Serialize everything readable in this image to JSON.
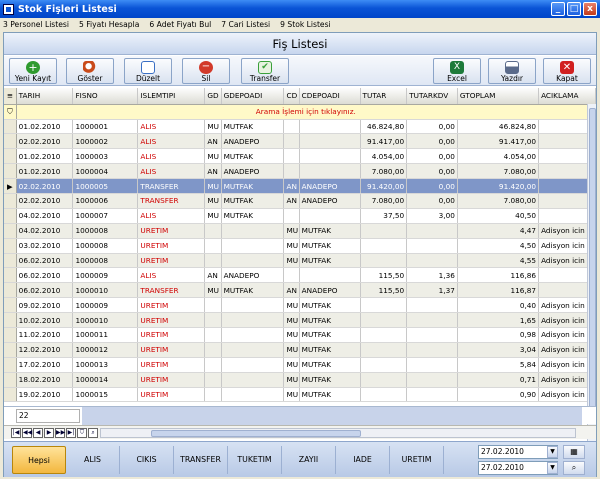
{
  "window": {
    "title": "Stok Fişleri Listesi",
    "minimize": "_",
    "maximize": "□",
    "close": "x"
  },
  "menu": [
    "3 Personel Listesi",
    "5 Fiyatı Hesapla",
    "6 Adet Fiyatı Bul",
    "7 Cari Listesi",
    "9 Stok Listesi"
  ],
  "header": {
    "title": "Fiş Listesi"
  },
  "toolbar": [
    {
      "label": "Yeni Kayıt",
      "icon": "add-icon",
      "color": "#2e9a2e"
    },
    {
      "label": "Göster",
      "icon": "search-icon",
      "color": "#c94a1a"
    },
    {
      "label": "Düzelt",
      "icon": "edit-icon",
      "color": "#3a6fc4"
    },
    {
      "label": "Sil",
      "icon": "delete-icon",
      "color": "#d23a2a"
    },
    {
      "label": "Transfer",
      "icon": "transfer-icon",
      "color": "#3aa03a"
    },
    {
      "label": "Excel",
      "icon": "excel-icon",
      "color": "#1d7a3a"
    },
    {
      "label": "Yazdır",
      "icon": "print-icon",
      "color": "#5a6a8a"
    },
    {
      "label": "Kapat",
      "icon": "close-icon",
      "color": "#d12020"
    }
  ],
  "grid": {
    "columns": [
      "TARIH",
      "FISNO",
      "ISLEMTIPI",
      "GD",
      "GDEPOADI",
      "CD",
      "CDEPOADI",
      "TUTAR",
      "TUTARKDV",
      "GTOPLAM",
      "ACIKLAMA"
    ],
    "filter_message": "Arama İşlemi için tıklayınız.",
    "rows": [
      [
        "01.02.2010",
        "1000001",
        "ALIS",
        "MU",
        "MUTFAK",
        "",
        "",
        "46.824,80",
        "0,00",
        "46.824,80",
        ""
      ],
      [
        "02.02.2010",
        "1000002",
        "ALIS",
        "AN",
        "ANADEPO",
        "",
        "",
        "91.417,00",
        "0,00",
        "91.417,00",
        ""
      ],
      [
        "01.02.2010",
        "1000003",
        "ALIS",
        "MU",
        "MUTFAK",
        "",
        "",
        "4.054,00",
        "0,00",
        "4.054,00",
        ""
      ],
      [
        "01.02.2010",
        "1000004",
        "ALIS",
        "AN",
        "ANADEPO",
        "",
        "",
        "7.080,00",
        "0,00",
        "7.080,00",
        ""
      ],
      [
        "02.02.2010",
        "1000005",
        "TRANSFER",
        "MU",
        "MUTFAK",
        "AN",
        "ANADEPO",
        "91.420,00",
        "0,00",
        "91.420,00",
        ""
      ],
      [
        "02.02.2010",
        "1000006",
        "TRANSFER",
        "MU",
        "MUTFAK",
        "AN",
        "ANADEPO",
        "7.080,00",
        "0,00",
        "7.080,00",
        ""
      ],
      [
        "04.02.2010",
        "1000007",
        "ALIS",
        "MU",
        "MUTFAK",
        "",
        "",
        "37,50",
        "3,00",
        "40,50",
        ""
      ],
      [
        "04.02.2010",
        "1000008",
        "URETIM",
        "",
        "",
        "MU",
        "MUTFAK",
        "",
        "",
        "4,47",
        "Adisyon icin"
      ],
      [
        "03.02.2010",
        "1000008",
        "URETIM",
        "",
        "",
        "MU",
        "MUTFAK",
        "",
        "",
        "4,50",
        "Adisyon icin"
      ],
      [
        "06.02.2010",
        "1000008",
        "URETIM",
        "",
        "",
        "MU",
        "MUTFAK",
        "",
        "",
        "4,55",
        "Adisyon icin"
      ],
      [
        "06.02.2010",
        "1000009",
        "ALIS",
        "AN",
        "ANADEPO",
        "",
        "",
        "115,50",
        "1,36",
        "116,86",
        ""
      ],
      [
        "06.02.2010",
        "1000010",
        "TRANSFER",
        "MU",
        "MUTFAK",
        "AN",
        "ANADEPO",
        "115,50",
        "1,37",
        "116,87",
        ""
      ],
      [
        "09.02.2010",
        "1000009",
        "URETIM",
        "",
        "",
        "MU",
        "MUTFAK",
        "",
        "",
        "0,40",
        "Adisyon icin"
      ],
      [
        "10.02.2010",
        "1000010",
        "URETIM",
        "",
        "",
        "MU",
        "MUTFAK",
        "",
        "",
        "1,65",
        "Adisyon icin"
      ],
      [
        "11.02.2010",
        "1000011",
        "URETIM",
        "",
        "",
        "MU",
        "MUTFAK",
        "",
        "",
        "0,98",
        "Adisyon icin"
      ],
      [
        "12.02.2010",
        "1000012",
        "URETIM",
        "",
        "",
        "MU",
        "MUTFAK",
        "",
        "",
        "3,04",
        "Adisyon icin"
      ],
      [
        "17.02.2010",
        "1000013",
        "URETIM",
        "",
        "",
        "MU",
        "MUTFAK",
        "",
        "",
        "5,84",
        "Adisyon icin"
      ],
      [
        "18.02.2010",
        "1000014",
        "URETIM",
        "",
        "",
        "MU",
        "MUTFAK",
        "",
        "",
        "0,71",
        "Adisyon icin"
      ],
      [
        "19.02.2010",
        "1000015",
        "URETIM",
        "",
        "",
        "MU",
        "MUTFAK",
        "",
        "",
        "0,90",
        "Adisyon icin"
      ]
    ],
    "selected_row": 4,
    "record_count": "22"
  },
  "tabs": [
    "Hepsi",
    "ALIS",
    "CIKIS",
    "TRANSFER",
    "TUKETIM",
    "ZAYII",
    "IADE",
    "URETIM"
  ],
  "active_tab": 0,
  "dates": {
    "start": "27.02.2010",
    "end": "27.02.2010"
  },
  "colors": {
    "accent": "#0a54d6",
    "selection": "#7f96c8",
    "filter_text": "#d00000"
  }
}
